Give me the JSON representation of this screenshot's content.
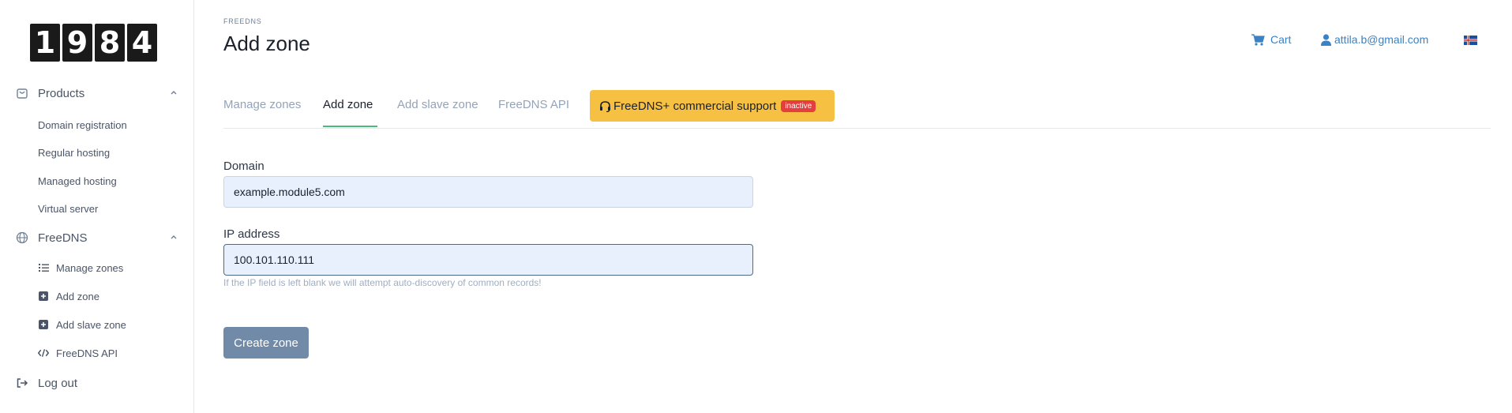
{
  "logo": {
    "digits": [
      "1",
      "9",
      "8",
      "4"
    ]
  },
  "sidebar": {
    "products": {
      "label": "Products",
      "items": [
        {
          "label": "Domain registration"
        },
        {
          "label": "Regular hosting"
        },
        {
          "label": "Managed hosting"
        },
        {
          "label": "Virtual server"
        }
      ]
    },
    "freedns": {
      "label": "FreeDNS",
      "items": [
        {
          "label": "Manage zones",
          "icon": "list-icon"
        },
        {
          "label": "Add zone",
          "icon": "plus-square-icon"
        },
        {
          "label": "Add slave zone",
          "icon": "plus-square-icon"
        },
        {
          "label": "FreeDNS API",
          "icon": "code-icon"
        }
      ]
    },
    "logout": {
      "label": "Log out"
    }
  },
  "header": {
    "eyebrow": "FREEDNS",
    "title": "Add zone",
    "cart_label": "Cart",
    "user_email": "attila.b@gmail.com"
  },
  "tabs": [
    {
      "label": "Manage zones",
      "active": false
    },
    {
      "label": "Add zone",
      "active": true
    },
    {
      "label": "Add slave zone",
      "active": false
    },
    {
      "label": "FreeDNS API",
      "active": false
    }
  ],
  "support": {
    "label": "FreeDNS+ commercial support",
    "badge": "inactive"
  },
  "form": {
    "domain_label": "Domain",
    "domain_value": "example.module5.com",
    "ip_label": "IP address",
    "ip_value": "100.101.110.111",
    "help_text": "If the IP field is left blank we will attempt auto-discovery of common records!",
    "submit_label": "Create zone"
  },
  "colors": {
    "accent_green": "#48bb78",
    "support_yellow": "#f6c142",
    "badge_red": "#e53e3e",
    "link_blue": "#3b82c4",
    "button": "#718aa8"
  }
}
